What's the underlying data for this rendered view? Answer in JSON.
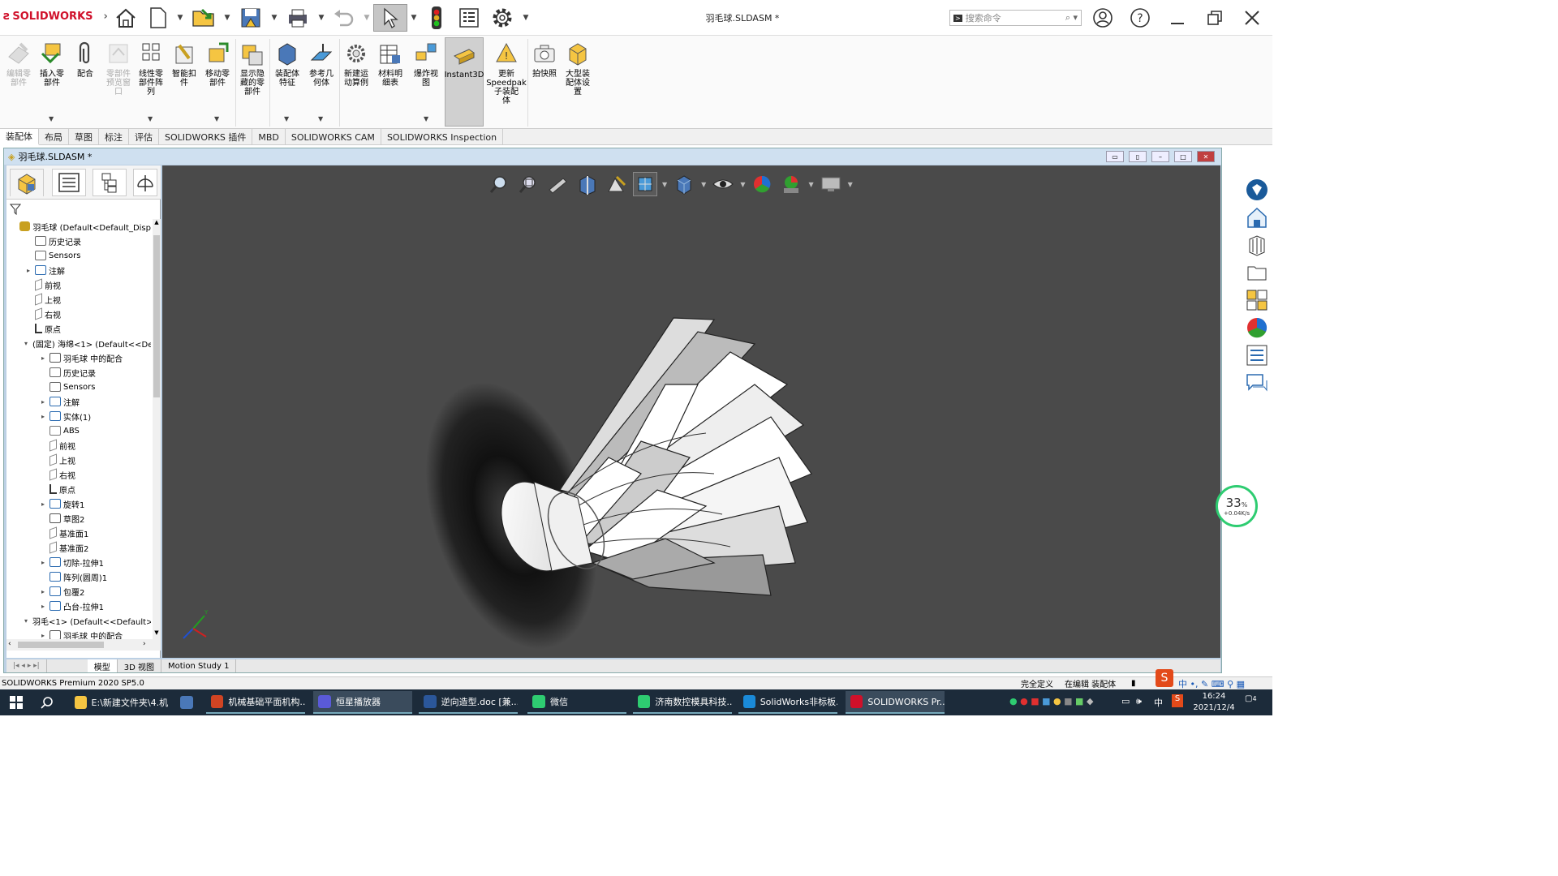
{
  "app": {
    "logo": "SOLIDWORKS",
    "document_title": "羽毛球.SLDASM *",
    "search_placeholder": "搜索命令"
  },
  "ribbon": {
    "buttons": [
      {
        "label": "编辑零\n部件",
        "state": "disabled"
      },
      {
        "label": "插入零\n部件",
        "state": "normal"
      },
      {
        "label": "配合",
        "state": "normal"
      },
      {
        "label": "零部件\n预览窗\n口",
        "state": "disabled"
      },
      {
        "label": "线性零\n部件阵\n列",
        "state": "normal"
      },
      {
        "label": "智能扣\n件",
        "state": "normal"
      },
      {
        "label": "移动零\n部件",
        "state": "normal"
      },
      {
        "label": "显示隐\n藏的零\n部件",
        "state": "normal"
      },
      {
        "label": "装配体\n特征",
        "state": "normal"
      },
      {
        "label": "参考几\n何体",
        "state": "normal"
      },
      {
        "label": "新建运\n动算例",
        "state": "normal"
      },
      {
        "label": "材料明\n细表",
        "state": "normal"
      },
      {
        "label": "爆炸视\n图",
        "state": "normal"
      },
      {
        "label": "Instant3D",
        "state": "active"
      },
      {
        "label": "更新\nSpeedpak\n子装配\n体",
        "state": "normal"
      },
      {
        "label": "拍快照",
        "state": "normal"
      },
      {
        "label": "大型装\n配体设\n置",
        "state": "normal"
      }
    ]
  },
  "command_tabs": [
    "装配体",
    "布局",
    "草图",
    "标注",
    "评估",
    "SOLIDWORKS 插件",
    "MBD",
    "SOLIDWORKS CAM",
    "SOLIDWORKS Inspection"
  ],
  "doc_window": {
    "title": "羽毛球.SLDASM *"
  },
  "feature_tree": {
    "items": [
      {
        "label": "羽毛球  (Default<Default_Disp",
        "indent": 0,
        "expander": "",
        "icon": "assembly"
      },
      {
        "label": "历史记录",
        "indent": 1,
        "expander": "",
        "icon": "history"
      },
      {
        "label": "Sensors",
        "indent": 1,
        "expander": "",
        "icon": "sensor"
      },
      {
        "label": "注解",
        "indent": 1,
        "expander": "▸",
        "icon": "annotation"
      },
      {
        "label": "前视",
        "indent": 1,
        "expander": "",
        "icon": "plane"
      },
      {
        "label": "上视",
        "indent": 1,
        "expander": "",
        "icon": "plane"
      },
      {
        "label": "右视",
        "indent": 1,
        "expander": "",
        "icon": "plane"
      },
      {
        "label": "原点",
        "indent": 1,
        "expander": "",
        "icon": "origin"
      },
      {
        "label": "(固定) 海绵<1> (Default<<De",
        "indent": 1,
        "expander": "▾",
        "icon": "part"
      },
      {
        "label": "羽毛球 中的配合",
        "indent": 2,
        "expander": "▸",
        "icon": "mates"
      },
      {
        "label": "历史记录",
        "indent": 2,
        "expander": "",
        "icon": "history"
      },
      {
        "label": "Sensors",
        "indent": 2,
        "expander": "",
        "icon": "sensor"
      },
      {
        "label": "注解",
        "indent": 2,
        "expander": "▸",
        "icon": "annotation"
      },
      {
        "label": "实体(1)",
        "indent": 2,
        "expander": "▸",
        "icon": "solid"
      },
      {
        "label": "ABS",
        "indent": 2,
        "expander": "",
        "icon": "material"
      },
      {
        "label": "前视",
        "indent": 2,
        "expander": "",
        "icon": "plane"
      },
      {
        "label": "上视",
        "indent": 2,
        "expander": "",
        "icon": "plane"
      },
      {
        "label": "右视",
        "indent": 2,
        "expander": "",
        "icon": "plane"
      },
      {
        "label": "原点",
        "indent": 2,
        "expander": "",
        "icon": "origin"
      },
      {
        "label": "旋转1",
        "indent": 2,
        "expander": "▸",
        "icon": "revolve"
      },
      {
        "label": "草图2",
        "indent": 2,
        "expander": "",
        "icon": "sketch"
      },
      {
        "label": "基准面1",
        "indent": 2,
        "expander": "",
        "icon": "plane"
      },
      {
        "label": "基准面2",
        "indent": 2,
        "expander": "",
        "icon": "plane"
      },
      {
        "label": "切除-拉伸1",
        "indent": 2,
        "expander": "▸",
        "icon": "cut"
      },
      {
        "label": "阵列(圆周)1",
        "indent": 2,
        "expander": "",
        "icon": "pattern"
      },
      {
        "label": "包覆2",
        "indent": 2,
        "expander": "▸",
        "icon": "wrap"
      },
      {
        "label": "凸台-拉伸1",
        "indent": 2,
        "expander": "▸",
        "icon": "extrude"
      },
      {
        "label": "羽毛<1> (Default<<Default>",
        "indent": 1,
        "expander": "▾",
        "icon": "part"
      },
      {
        "label": "羽毛球 中的配合",
        "indent": 2,
        "expander": "▸",
        "icon": "mates"
      }
    ]
  },
  "bottom_tabs": [
    "模型",
    "3D 视图",
    "Motion Study 1"
  ],
  "status_bar": {
    "left": "SOLIDWORKS Premium 2020 SP5.0",
    "defined": "完全定义",
    "editing": "在编辑 装配体"
  },
  "network_monitor": {
    "percent": "33",
    "unit": "%",
    "speed": "+0.04K/s"
  },
  "taskbar": {
    "items": [
      {
        "label": "E:\\新建文件夹\\4.机...",
        "icon": "folder-icon",
        "state": "normal"
      },
      {
        "label": "",
        "icon": "pen-icon",
        "state": "normal"
      },
      {
        "label": "机械基础平面机构...",
        "icon": "powerpoint-icon",
        "state": "open"
      },
      {
        "label": "恒星播放器",
        "icon": "player-icon",
        "state": "active"
      },
      {
        "label": "逆向造型.doc [兼...",
        "icon": "word-icon",
        "state": "open"
      },
      {
        "label": "微信",
        "icon": "wechat-icon",
        "state": "open"
      },
      {
        "label": "济南数控模具科技...",
        "icon": "wechat-icon",
        "state": "open"
      },
      {
        "label": "SolidWorks非标板...",
        "icon": "edge-icon",
        "state": "open"
      },
      {
        "label": "SOLIDWORKS Pr...",
        "icon": "solidworks-icon",
        "state": "active"
      }
    ],
    "ime": "中",
    "time": "16:24",
    "date": "2021/12/4",
    "notifications": "4"
  },
  "colors": {
    "accent": "#d0102a",
    "viewport_bg": "#4a4a4a",
    "taskbar_bg": "#1c2b3a"
  }
}
